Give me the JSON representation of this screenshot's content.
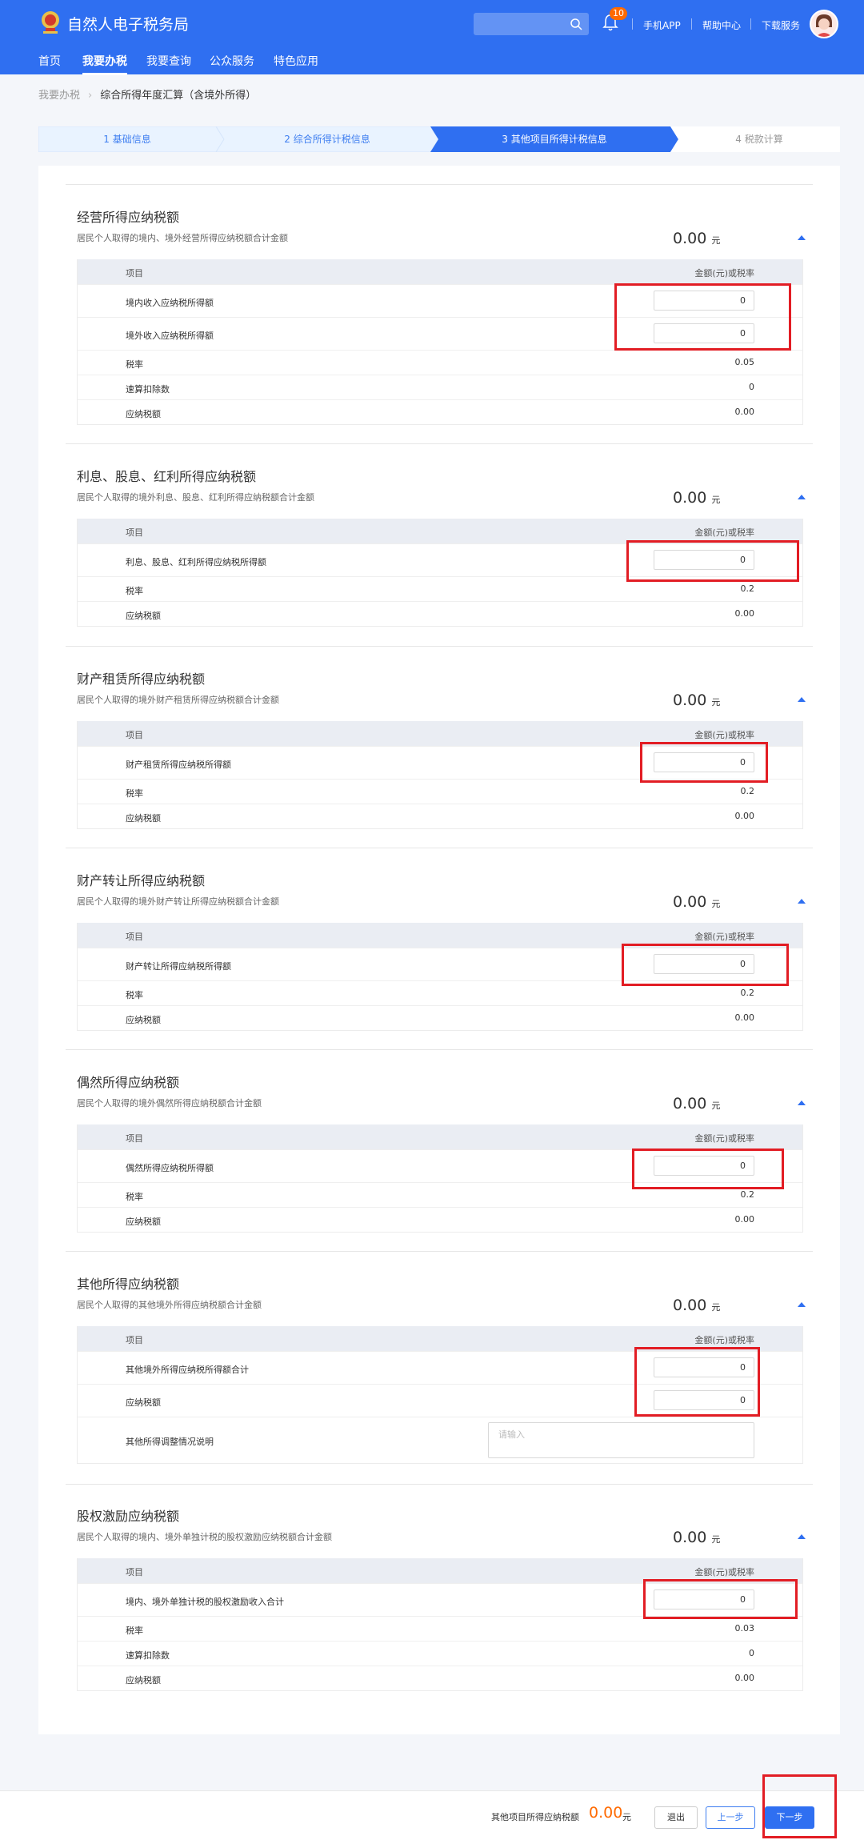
{
  "header": {
    "site_title": "自然人电子税务局",
    "notification_count": "10",
    "links": [
      "手机APP",
      "帮助中心",
      "下载服务"
    ],
    "nav": [
      "首页",
      "我要办税",
      "我要查询",
      "公众服务",
      "特色应用"
    ],
    "active_nav": "我要办税"
  },
  "breadcrumb": {
    "parent": "我要办税",
    "current": "综合所得年度汇算（含境外所得）"
  },
  "steps": [
    {
      "label": "1 基础信息",
      "state": "done"
    },
    {
      "label": "2 综合所得计税信息",
      "state": "done"
    },
    {
      "label": "3 其他项目所得计税信息",
      "state": "active"
    },
    {
      "label": "4 税款计算",
      "state": "todo"
    }
  ],
  "table_headers": {
    "item": "项目",
    "amount": "金额(元)或税率"
  },
  "unit": "元",
  "sections": [
    {
      "title": "经营所得应纳税额",
      "desc": "居民个人取得的境内、境外经营所得应纳税额合计金额",
      "total": "0.00",
      "rows": [
        {
          "label": "境内收入应纳税所得额",
          "input": "0"
        },
        {
          "label": "境外收入应纳税所得额",
          "input": "0"
        },
        {
          "label": "税率",
          "value": "0.05"
        },
        {
          "label": "速算扣除数",
          "value": "0"
        },
        {
          "label": "应纳税额",
          "value": "0.00"
        }
      ]
    },
    {
      "title": "利息、股息、红利所得应纳税额",
      "desc": "居民个人取得的境外利息、股息、红利所得应纳税额合计金额",
      "total": "0.00",
      "rows": [
        {
          "label": "利息、股息、红利所得应纳税所得额",
          "input": "0"
        },
        {
          "label": "税率",
          "value": "0.2"
        },
        {
          "label": "应纳税额",
          "value": "0.00"
        }
      ]
    },
    {
      "title": "财产租赁所得应纳税额",
      "desc": "居民个人取得的境外财产租赁所得应纳税额合计金额",
      "total": "0.00",
      "rows": [
        {
          "label": "财产租赁所得应纳税所得额",
          "input": "0"
        },
        {
          "label": "税率",
          "value": "0.2"
        },
        {
          "label": "应纳税额",
          "value": "0.00"
        }
      ]
    },
    {
      "title": "财产转让所得应纳税额",
      "desc": "居民个人取得的境外财产转让所得应纳税额合计金额",
      "total": "0.00",
      "rows": [
        {
          "label": "财产转让所得应纳税所得额",
          "input": "0"
        },
        {
          "label": "税率",
          "value": "0.2"
        },
        {
          "label": "应纳税额",
          "value": "0.00"
        }
      ]
    },
    {
      "title": "偶然所得应纳税额",
      "desc": "居民个人取得的境外偶然所得应纳税额合计金额",
      "total": "0.00",
      "rows": [
        {
          "label": "偶然所得应纳税所得额",
          "input": "0"
        },
        {
          "label": "税率",
          "value": "0.2"
        },
        {
          "label": "应纳税额",
          "value": "0.00"
        }
      ]
    },
    {
      "title": "其他所得应纳税额",
      "desc": "居民个人取得的其他境外所得应纳税额合计金额",
      "total": "0.00",
      "rows": [
        {
          "label": "其他境外所得应纳税所得额合计",
          "input": "0"
        },
        {
          "label": "应纳税额",
          "input": "0"
        },
        {
          "label": "其他所得调整情况说明",
          "placeholder": "请输入"
        }
      ]
    },
    {
      "title": "股权激励应纳税额",
      "desc": "居民个人取得的境内、境外单独计税的股权激励应纳税额合计金额",
      "total": "0.00",
      "rows": [
        {
          "label": "境内、境外单独计税的股权激励收入合计",
          "input": "0"
        },
        {
          "label": "税率",
          "value": "0.03"
        },
        {
          "label": "速算扣除数",
          "value": "0"
        },
        {
          "label": "应纳税额",
          "value": "0.00"
        }
      ]
    }
  ],
  "footer": {
    "label": "其他项目所得应纳税额",
    "amount": "0.00",
    "unit": "元",
    "exit": "退出",
    "prev": "上一步",
    "next": "下一步"
  },
  "colors": {
    "brand": "#2f6ff1",
    "highlight": "#e21d24",
    "amount": "#ff6a00"
  }
}
